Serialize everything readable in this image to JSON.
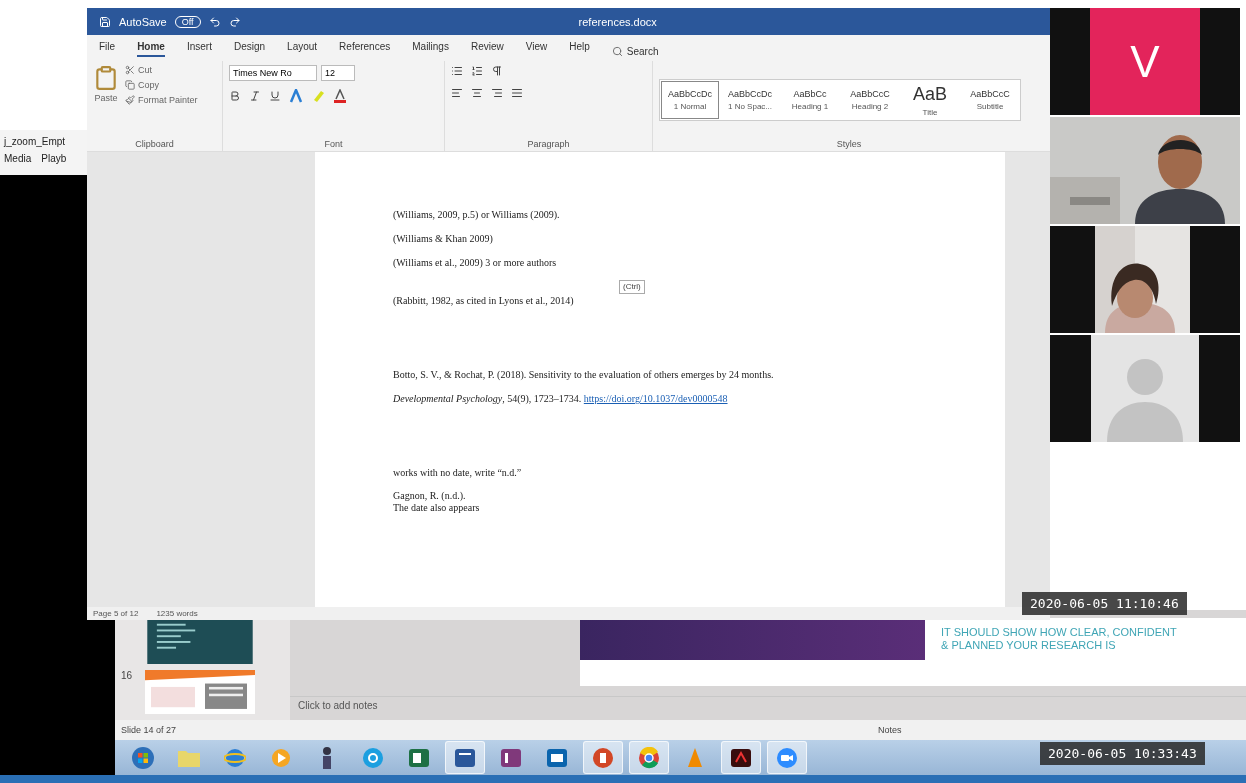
{
  "word": {
    "autosave": "AutoSave",
    "autosave_state": "Off",
    "title": "references.docx",
    "tabs": [
      {
        "label": "File",
        "selected": false
      },
      {
        "label": "Home",
        "selected": true
      },
      {
        "label": "Insert",
        "selected": false
      },
      {
        "label": "Design",
        "selected": false
      },
      {
        "label": "Layout",
        "selected": false
      },
      {
        "label": "References",
        "selected": false
      },
      {
        "label": "Mailings",
        "selected": false
      },
      {
        "label": "Review",
        "selected": false
      },
      {
        "label": "View",
        "selected": false
      },
      {
        "label": "Help",
        "selected": false
      }
    ],
    "search": "Search",
    "clipboard": {
      "paste": "Paste",
      "cut": "Cut",
      "copy": "Copy",
      "format_painter": "Format Painter",
      "label": "Clipboard"
    },
    "font": {
      "name": "Times New Ro",
      "size": "12",
      "label": "Font"
    },
    "paragraph": {
      "label": "Paragraph"
    },
    "styles": {
      "label": "Styles",
      "items": [
        {
          "sample": "AaBbCcDc",
          "name": "1 Normal",
          "selected": true
        },
        {
          "sample": "AaBbCcDc",
          "name": "1 No Spac...",
          "selected": false
        },
        {
          "sample": "AaBbCc",
          "name": "Heading 1",
          "selected": false
        },
        {
          "sample": "AaBbCcC",
          "name": "Heading 2",
          "selected": false
        },
        {
          "sample": "AaB",
          "name": "Title",
          "selected": false
        },
        {
          "sample": "AaBbCcC",
          "name": "Subtitle",
          "selected": false
        }
      ]
    },
    "paragraphs": [
      {
        "kind": "line",
        "text": "(Williams, 2009, p.5) or Williams (2009)."
      },
      {
        "kind": "line",
        "text": "(Williams & Khan 2009)"
      },
      {
        "kind": "line",
        "text": "(Williams et al., 2009) 3 or more authors"
      },
      {
        "kind": "paste",
        "text": "(Ctrl)"
      },
      {
        "kind": "line",
        "text": "(Rabbitt, 1982, as cited in Lyons et al., 2014)"
      },
      {
        "kind": "gap"
      },
      {
        "kind": "line",
        "text": "Botto, S. V., & Rochat, P. (2018). Sensitivity to the evaluation of others emerges by 24 months."
      },
      {
        "kind": "line",
        "text": "*Developmental Psychology*, 54(9), 1723–1734. ",
        "link": "https://doi.org/10.1037/dev0000548"
      },
      {
        "kind": "gap"
      },
      {
        "kind": "line",
        "text": "works with no date, write “n.d.”"
      },
      {
        "kind": "tight",
        "text": "Gagnon, R. (n.d.)."
      },
      {
        "kind": "tight",
        "text": "The date also appears"
      }
    ],
    "status": {
      "page": "Page 5 of 12",
      "words": "1235 words"
    }
  },
  "background_window": {
    "title": "j_zoom_Empt",
    "menu": [
      "Media",
      "Playb"
    ]
  },
  "presentation": {
    "thumbnails": [
      {
        "kind": "dark"
      },
      {
        "kind": "orange",
        "number": "16"
      }
    ],
    "slide_text": "IT SHOULD SHOW HOW CLEAR, CONFIDENT & PLANNED YOUR RESEARCH IS",
    "notes_placeholder": "Click to add notes",
    "status": "Slide 14 of 27",
    "notes_button": "Notes"
  },
  "video_tiles": [
    {
      "kind": "initial",
      "initial": "V",
      "color": "#e3245b"
    },
    {
      "kind": "person"
    },
    {
      "kind": "person2"
    },
    {
      "kind": "avatar"
    }
  ],
  "timestamps": [
    "2020-06-05 11:10:46",
    "2020-06-05 10:33:43"
  ],
  "taskbar": [
    {
      "kind": "start",
      "open": false
    },
    {
      "kind": "folder",
      "open": false
    },
    {
      "kind": "ie",
      "open": false
    },
    {
      "kind": "media",
      "open": false
    },
    {
      "kind": "figure",
      "open": false
    },
    {
      "kind": "skype",
      "open": false
    },
    {
      "kind": "excel",
      "open": false
    },
    {
      "kind": "word",
      "open": true
    },
    {
      "kind": "onenote",
      "open": false
    },
    {
      "kind": "outlook",
      "open": false
    },
    {
      "kind": "powerpoint",
      "open": true
    },
    {
      "kind": "chrome",
      "open": true
    },
    {
      "kind": "vlc",
      "open": false
    },
    {
      "kind": "acrobat",
      "open": true
    },
    {
      "kind": "zoom",
      "open": true
    }
  ]
}
